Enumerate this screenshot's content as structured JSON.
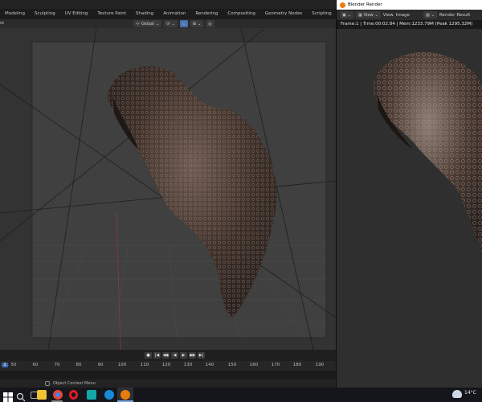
{
  "workspace_tabs": [
    "Modeling",
    "Sculpting",
    "UV Editing",
    "Texture Paint",
    "Shading",
    "Animation",
    "Rendering",
    "Compositing",
    "Geometry Nodes",
    "Scripting"
  ],
  "workspace_add": "+",
  "header": {
    "left_text": "ct",
    "transform_orientation": "Global"
  },
  "playback_controls": [
    "●",
    "|◀",
    "◀◆",
    "◀",
    "▶",
    "◆▶",
    "▶|"
  ],
  "timeline_ticks": [
    "50",
    "60",
    "70",
    "80",
    "90",
    "100",
    "110",
    "120",
    "130",
    "140",
    "150",
    "160",
    "170",
    "180",
    "190"
  ],
  "timeline_selected": "1",
  "status_bar": {
    "text": "Object Context Menu"
  },
  "render_window": {
    "title": "Blender Render",
    "menu_view": "View",
    "menu_view2": "View",
    "menu_image": "Image",
    "slot_label": "Render Result",
    "info": "Frame:1 | Time:00:02.84 | Mem:1233.79M (Peak 1295.32M)"
  },
  "taskbar": {
    "temperature": "14°C",
    "apps": [
      "windows-start",
      "search",
      "task-view",
      "file-explorer",
      "chrome",
      "opera",
      "app-mx",
      "app-c",
      "blender"
    ]
  },
  "colors": {
    "accent_blue": "#4772b3",
    "blender_orange": "#e87d0d",
    "hair_dark": "#2a201c",
    "hair_light": "#8a7a70"
  }
}
